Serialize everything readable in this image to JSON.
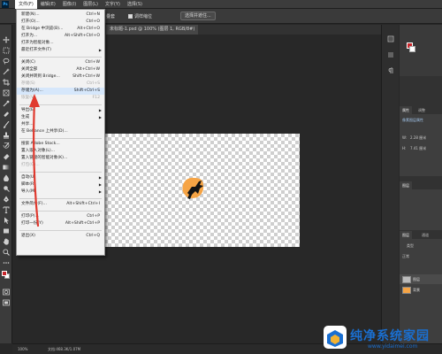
{
  "app": {
    "logo_text": "Ps"
  },
  "menubar": {
    "items": [
      "文件(F)",
      "编辑(E)",
      "图像(I)",
      "图层(L)",
      "文字(Y)",
      "选择(S)"
    ]
  },
  "options": {
    "left_text": "叠套",
    "checkbox_label": "调样缩位",
    "button_label": "选择并遮住..."
  },
  "document": {
    "tab_label": "未标题-1.psd @ 100% (图层 1, RGB/8#)"
  },
  "file_menu": {
    "items": [
      {
        "label": "新建(N)...",
        "shortcut": "Ctrl+N"
      },
      {
        "label": "打开(O)...",
        "shortcut": "Ctrl+O"
      },
      {
        "label": "在 Bridge 中浏览(B)...",
        "shortcut": "Alt+Ctrl+O"
      },
      {
        "label": "打开为...",
        "shortcut": "Alt+Shift+Ctrl+O"
      },
      {
        "label": "打开为智能对象...",
        "shortcut": ""
      },
      {
        "label": "最近打开文件(T)",
        "shortcut": "",
        "submenu": true
      },
      {
        "label": "关闭(C)",
        "shortcut": "Ctrl+W"
      },
      {
        "label": "关闭全部",
        "shortcut": "Alt+Ctrl+W"
      },
      {
        "label": "关闭并转到 Bridge...",
        "shortcut": "Shift+Ctrl+W"
      },
      {
        "label": "存储(S)",
        "shortcut": "Ctrl+S",
        "disabled": true
      },
      {
        "label": "存储为(A)...",
        "shortcut": "Shift+Ctrl+S"
      },
      {
        "label": "恢复(V)",
        "shortcut": "F12",
        "disabled": true
      },
      {
        "label": "导出(E)",
        "shortcut": "",
        "submenu": true
      },
      {
        "label": "生成",
        "shortcut": "",
        "submenu": true
      },
      {
        "label": "共享...",
        "shortcut": ""
      },
      {
        "label": "在 Behance 上共享(D)...",
        "shortcut": ""
      },
      {
        "label": "搜索 Adobe Stock...",
        "shortcut": ""
      },
      {
        "label": "置入嵌入对象(L)...",
        "shortcut": ""
      },
      {
        "label": "置入链接的智能对象(K)...",
        "shortcut": ""
      },
      {
        "label": "打包(G)...",
        "shortcut": "",
        "disabled": true
      },
      {
        "label": "自动(U)",
        "shortcut": "",
        "submenu": true
      },
      {
        "label": "脚本(R)",
        "shortcut": "",
        "submenu": true
      },
      {
        "label": "导入(M)",
        "shortcut": "",
        "submenu": true
      },
      {
        "label": "文件简介(F)...",
        "shortcut": "Alt+Shift+Ctrl+I"
      },
      {
        "label": "打印(P)...",
        "shortcut": "Ctrl+P"
      },
      {
        "label": "打印一份(Y)",
        "shortcut": "Alt+Shift+Ctrl+P"
      },
      {
        "label": "退出(X)",
        "shortcut": "Ctrl+Q"
      }
    ]
  },
  "panels": {
    "top_tabs": [
      "属性",
      "调整"
    ],
    "props_title": "像素图层属性",
    "w_label": "W:",
    "w_value": "2.28 厘米",
    "h_label": "H:",
    "h_value": "7.41 厘米",
    "middle_tab": "图层",
    "layer_tabs": [
      "图层",
      "通道"
    ],
    "layer_kind": "类型",
    "blend_mode": "正常",
    "layers": [
      "图层",
      "背景"
    ]
  },
  "status": {
    "zoom": "100%",
    "doc_info": "文档:468.3K/1.07M"
  },
  "watermark": {
    "name": "纯净系统家园",
    "url": "www.yidaimei.com"
  },
  "colors": {
    "accent": "#d6e7fb",
    "arrow": "#e03a2f",
    "watermark": "#1a6fd1",
    "artwork": "#f6a445"
  }
}
